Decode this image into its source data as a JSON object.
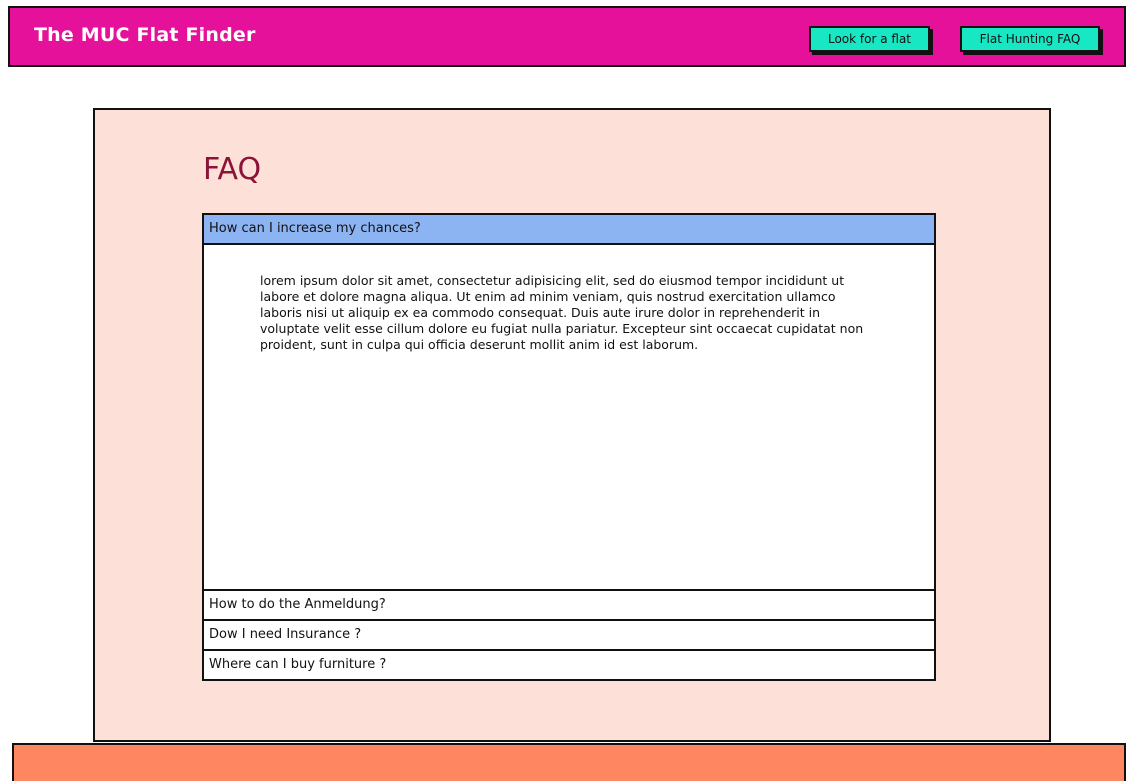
{
  "header": {
    "title": "The MUC Flat Finder",
    "nav": [
      {
        "label": "Look for a flat"
      },
      {
        "label": "Flat Hunting FAQ"
      }
    ]
  },
  "faq": {
    "heading": "FAQ",
    "items": [
      {
        "question": "How can I increase my chances?",
        "expanded": true,
        "answer": "lorem ipsum dolor sit amet, consectetur adipisicing elit, sed do eiusmod tempor incididunt ut labore et dolore magna aliqua. Ut enim ad minim veniam, quis nostrud exercitation ullamco laboris nisi ut aliquip ex ea commodo consequat. Duis aute irure dolor in reprehenderit in voluptate velit esse cillum dolore eu fugiat nulla pariatur. Excepteur sint occaecat cupidatat non proident, sunt in culpa qui officia deserunt mollit anim id est laborum."
      },
      {
        "question": "How to do the Anmeldung?",
        "expanded": false
      },
      {
        "question": "Dow I need Insurance ?",
        "expanded": false
      },
      {
        "question": "Where can I buy furniture ?",
        "expanded": false
      }
    ]
  },
  "colors": {
    "header_bg": "#e6119a",
    "nav_button_bg": "#17e8c3",
    "card_bg": "#fde1d9",
    "faq_heading": "#8b1337",
    "active_item_bg": "#8cb4f2",
    "footer_bg": "#fe8660"
  }
}
